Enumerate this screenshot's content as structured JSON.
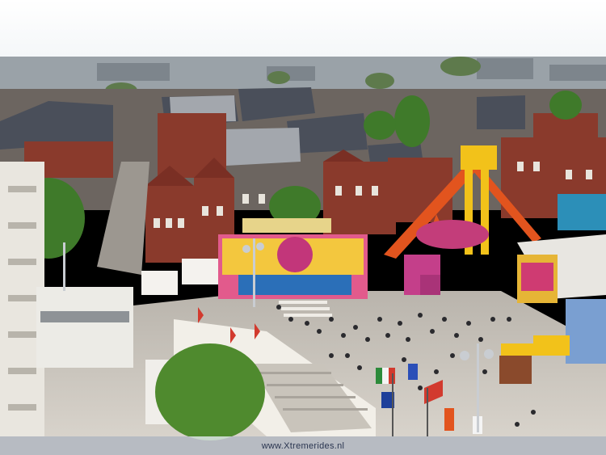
{
  "photo": {
    "subject": "",
    "watermark": "www.Xtremerides.nl"
  },
  "colors": {
    "sky": "#f4f6f8",
    "roof_dark": "#4a4f5a",
    "brick": "#8a3a2c",
    "ride_arm": "#e2541e",
    "ride_yellow": "#f2c21a",
    "tree": "#3f7a2a",
    "pavement": "#cfcac2"
  }
}
